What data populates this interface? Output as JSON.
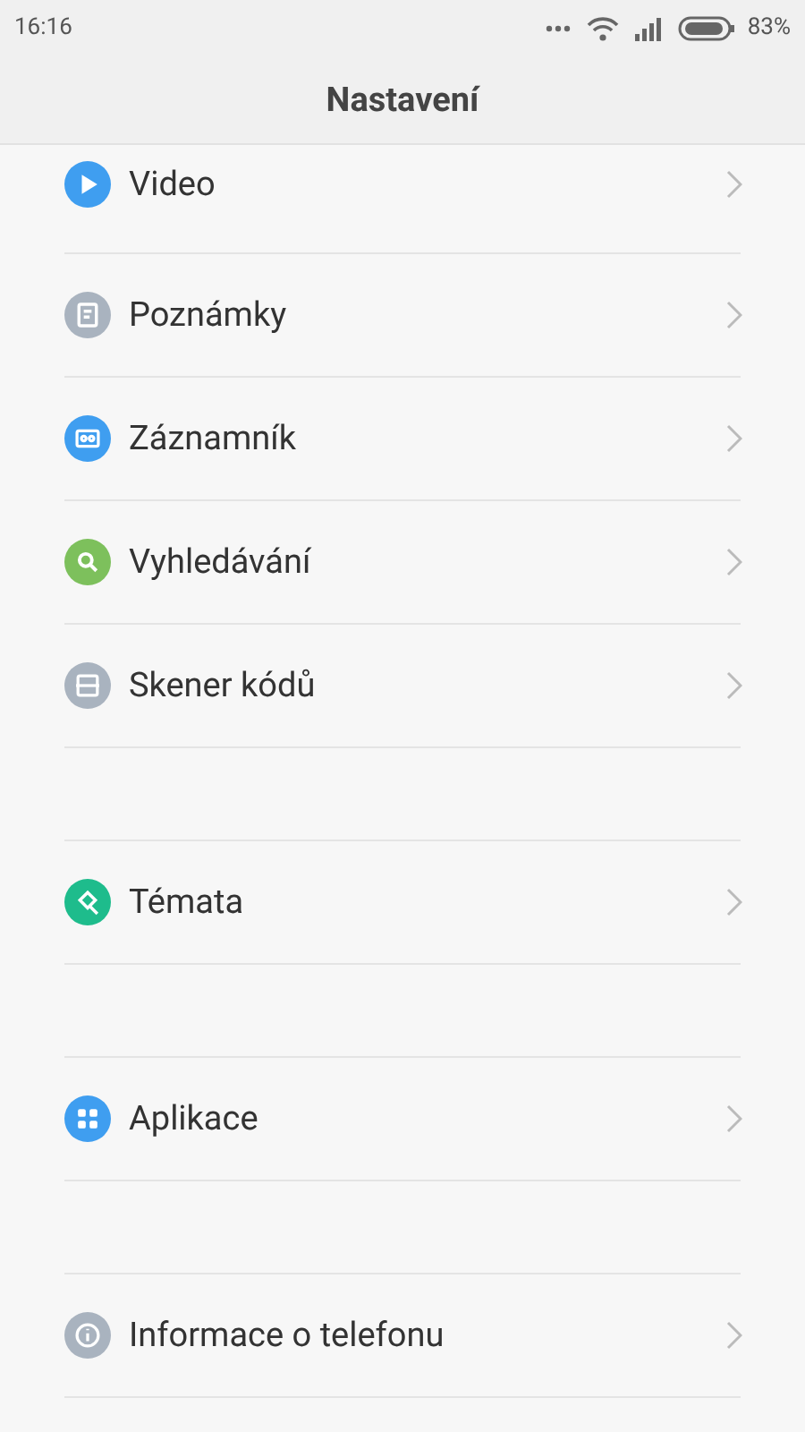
{
  "status_bar": {
    "time": "16:16",
    "battery": "83%"
  },
  "header": {
    "title": "Nastavení"
  },
  "groups": [
    {
      "items": [
        {
          "label": "Video",
          "color": "#3f9ef0"
        },
        {
          "label": "Poznámky",
          "color": "#a9b3bf"
        },
        {
          "label": "Záznamník",
          "color": "#3f9ef0"
        },
        {
          "label": "Vyhledávání",
          "color": "#7dc05c"
        },
        {
          "label": "Skener kódů",
          "color": "#a9b3bf"
        }
      ]
    },
    {
      "items": [
        {
          "label": "Témata",
          "color": "#1ebc8c"
        }
      ]
    },
    {
      "items": [
        {
          "label": "Aplikace",
          "color": "#3f9ef0"
        }
      ]
    },
    {
      "items": [
        {
          "label": "Informace o telefonu",
          "color": "#a9b3bf"
        }
      ]
    }
  ]
}
